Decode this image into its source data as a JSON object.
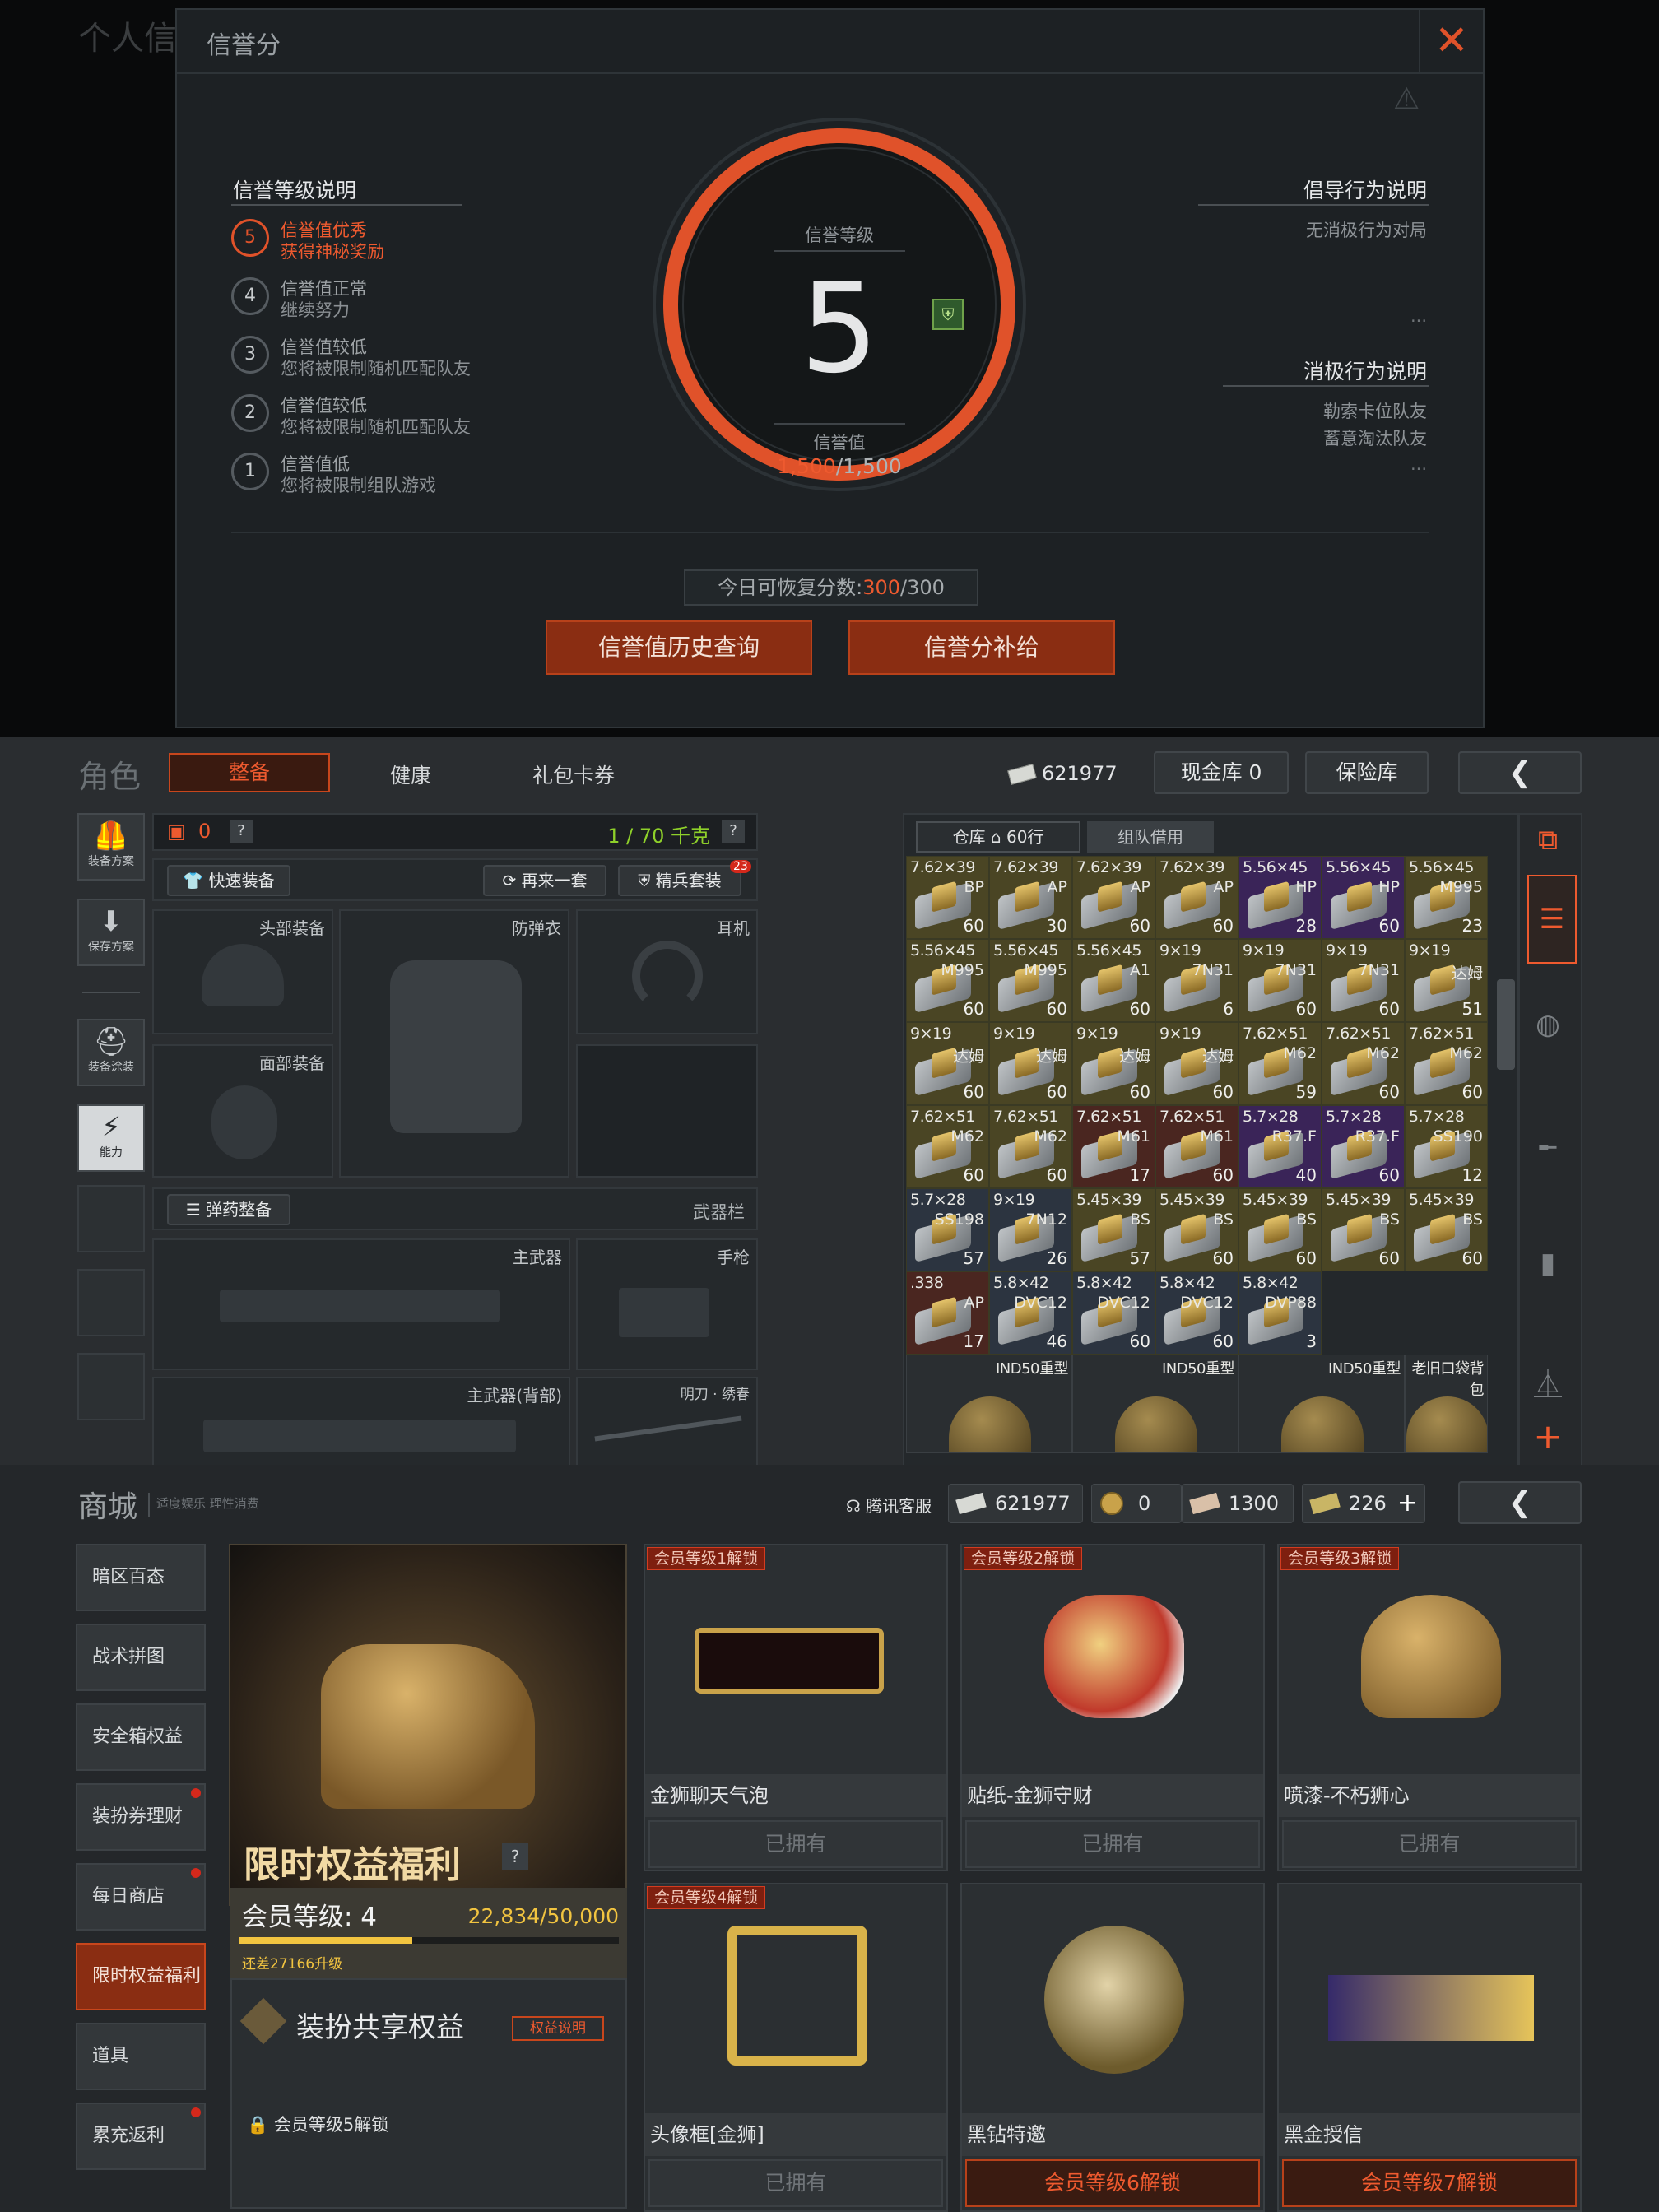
{
  "reputation": {
    "bg_title": "个人信",
    "title": "信誉分",
    "left_header": "信誉等级说明",
    "levels": [
      {
        "n": "5",
        "t1": "信誉值优秀",
        "t2": "获得神秘奖励",
        "active": true
      },
      {
        "n": "4",
        "t1": "信誉值正常",
        "t2": "继续努力"
      },
      {
        "n": "3",
        "t1": "信誉值较低",
        "t2": "您将被限制随机匹配队友"
      },
      {
        "n": "2",
        "t1": "信誉值较低",
        "t2": "您将被限制随机匹配队友"
      },
      {
        "n": "1",
        "t1": "信誉值低",
        "t2": "您将被限制组队游戏"
      }
    ],
    "gauge_label": "信誉等级",
    "gauge_level": "5",
    "score_label": "信誉值",
    "score_current": "1,500",
    "score_max": "/1,500",
    "positive_header": "倡导行为说明",
    "positive_items": [
      "无消极行为对局"
    ],
    "negative_header": "消极行为说明",
    "negative_items": [
      "勒索卡位队友",
      "蓄意淘汰队友"
    ],
    "ellipsis": "...",
    "recover_label": "今日可恢复分数:",
    "recover_current": "300",
    "recover_max": "/300",
    "btn_history": "信誉值历史查询",
    "btn_compensate": "信誉分补给",
    "accent": "#e0522a"
  },
  "inventory": {
    "page_title": "角色",
    "tabs": [
      "整备",
      "健康",
      "礼包卡券"
    ],
    "currency": "621977",
    "cash_btn": "现金库 0",
    "safe_btn": "保险库",
    "armor_count": "0",
    "weight": "1 / 70 千克",
    "quick_equip": "快速装备",
    "again": "再来一套",
    "elite": "精兵套装",
    "elite_badge": "23",
    "side": [
      "装备方案",
      "保存方案",
      "装备涂装",
      "能力"
    ],
    "slots": {
      "head": "头部装备",
      "body": "防弹衣",
      "ear": "耳机",
      "face": "面部装备",
      "primary": "主武器",
      "pistol": "手枪",
      "primary2": "主武器(背部)",
      "melee": "明刀 · 绣春"
    },
    "ammo_btn": "弹药整备",
    "weapon_bar": "武器栏",
    "storage_tab": "仓库",
    "storage_rows": "60行",
    "team_tab": "组队借用",
    "grid": [
      [
        "7.62×39",
        "BP",
        "60"
      ],
      [
        "7.62×39",
        "AP",
        "30"
      ],
      [
        "7.62×39",
        "AP",
        "60"
      ],
      [
        "7.62×39",
        "AP",
        "60"
      ],
      [
        "5.56×45",
        "HP",
        "28"
      ],
      [
        "5.56×45",
        "HP",
        "60"
      ],
      [
        "5.56×45",
        "M995",
        "23"
      ],
      [
        "5.56×45",
        "M995",
        "60"
      ],
      [
        "5.56×45",
        "M995",
        "60"
      ],
      [
        "5.56×45",
        "A1",
        "60"
      ],
      [
        "9×19",
        "7N31",
        "6"
      ],
      [
        "9×19",
        "7N31",
        "60"
      ],
      [
        "9×19",
        "7N31",
        "60"
      ],
      [
        "9×19",
        "达姆",
        "51"
      ],
      [
        "9×19",
        "达姆",
        "60"
      ],
      [
        "9×19",
        "达姆",
        "60"
      ],
      [
        "9×19",
        "达姆",
        "60"
      ],
      [
        "9×19",
        "达姆",
        "60"
      ],
      [
        "7.62×51",
        "M62",
        "59"
      ],
      [
        "7.62×51",
        "M62",
        "60"
      ],
      [
        "7.62×51",
        "M62",
        "60"
      ],
      [
        "7.62×51",
        "M62",
        "60"
      ],
      [
        "7.62×51",
        "M62",
        "60"
      ],
      [
        "7.62×51",
        "M61",
        "17"
      ],
      [
        "7.62×51",
        "M61",
        "60"
      ],
      [
        "5.7×28",
        "R37.F",
        "40"
      ],
      [
        "5.7×28",
        "R37.F",
        "60"
      ],
      [
        "5.7×28",
        "SS190",
        "12"
      ],
      [
        "5.7×28",
        "SS198",
        "57"
      ],
      [
        "9×19",
        "7N12",
        "26"
      ],
      [
        "5.45×39",
        "BS",
        "57"
      ],
      [
        "5.45×39",
        "BS",
        "60"
      ],
      [
        "5.45×39",
        "BS",
        "60"
      ],
      [
        "5.45×39",
        "BS",
        "60"
      ],
      [
        "5.45×39",
        "BS",
        "60"
      ],
      [
        ".338",
        "AP",
        "17"
      ],
      [
        "5.8×42",
        "DVC12",
        "46"
      ],
      [
        "5.8×42",
        "DVC12",
        "60"
      ],
      [
        "5.8×42",
        "DVC12",
        "60"
      ],
      [
        "5.8×42",
        "DVP88",
        "3"
      ]
    ],
    "bottom_items": [
      "IND50重型",
      "IND50重型",
      "IND50重型",
      "老旧口袋背包"
    ]
  },
  "shop": {
    "title": "商城",
    "subtitle": "适度娱乐 理性消费",
    "service": "腾讯客服",
    "cur1": "621977",
    "cur2": "0",
    "cur3": "1300",
    "cur4": "226",
    "menu": [
      "暗区百态",
      "战术拼图",
      "安全箱权益",
      "装扮券理财",
      "每日商店",
      "限时权益福利",
      "道具",
      "累充返利"
    ],
    "banner_title": "限时权益福利",
    "vip_label": "会员等级: 4",
    "vip_progress": "22,834/50,000",
    "vip_fraction": 0.4567,
    "vip_diff": "还差27166升级",
    "share_title": "装扮共享权益",
    "share_btn": "权益说明",
    "share_lock": "会员等级5解锁",
    "cards": [
      {
        "tag": "会员等级1解锁",
        "name": "金狮聊天气泡",
        "status": "已拥有",
        "locked": false
      },
      {
        "tag": "会员等级2解锁",
        "name": "贴纸-金狮守财",
        "status": "已拥有",
        "locked": false
      },
      {
        "tag": "会员等级3解锁",
        "name": "喷漆-不朽狮心",
        "status": "已拥有",
        "locked": false
      },
      {
        "tag": "会员等级4解锁",
        "name": "头像框[金狮]",
        "status": "已拥有",
        "locked": false
      },
      {
        "tag": "",
        "name": "黑钻特邀",
        "status": "会员等级6解锁",
        "locked": true
      },
      {
        "tag": "",
        "name": "黑金授信",
        "status": "会员等级7解锁",
        "locked": true
      }
    ]
  }
}
